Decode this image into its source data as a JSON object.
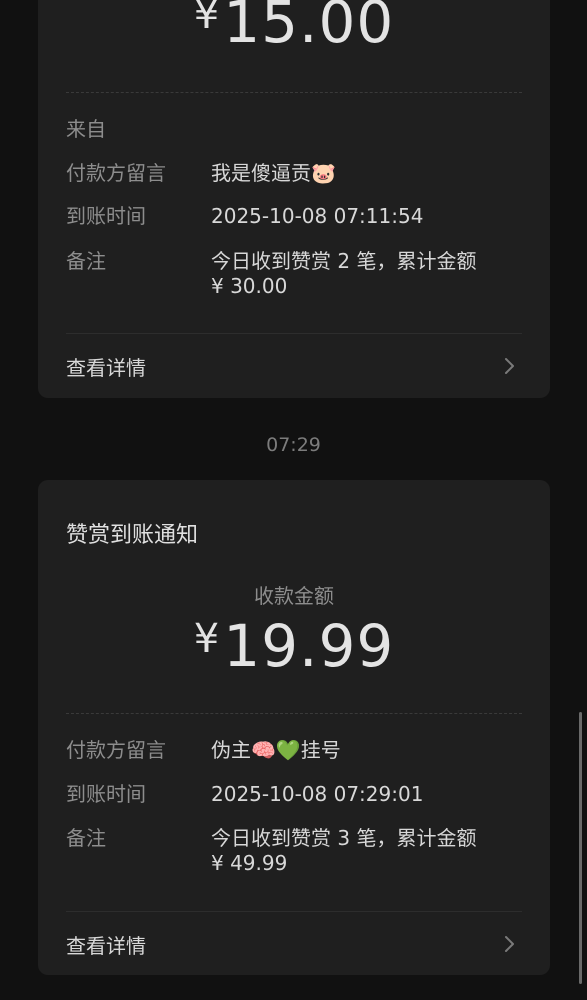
{
  "messages": [
    {
      "amount_currency": "¥",
      "amount_value": "15.00",
      "fields": {
        "from_label": "来自",
        "from_value": "",
        "message_label": "付款方留言",
        "message_value": "我是傻逼贡🐷",
        "time_label": "到账时间",
        "time_value": "2025-10-08 07:11:54",
        "note_label": "备注",
        "note_line1": "今日收到赞赏 2 笔，累计金额",
        "note_line2": "¥ 30.00"
      },
      "details_label": "查看详情"
    },
    {
      "title": "赞赏到账通知",
      "amount_label": "收款金额",
      "amount_currency": "¥",
      "amount_value": "19.99",
      "fields": {
        "message_label": "付款方留言",
        "message_value": "伪主🧠💚挂号",
        "time_label": "到账时间",
        "time_value": "2025-10-08 07:29:01",
        "note_label": "备注",
        "note_line1": "今日收到赞赏 3 笔，累计金额",
        "note_line2": "¥ 49.99"
      },
      "details_label": "查看详情"
    }
  ],
  "time_separator": "07:29",
  "icons": {
    "chevron": "chevron-right-icon"
  },
  "colors": {
    "background": "#111111",
    "card": "#1f1f1f",
    "label_gray": "#8d8d8d",
    "text_light": "#d8d8d8"
  }
}
